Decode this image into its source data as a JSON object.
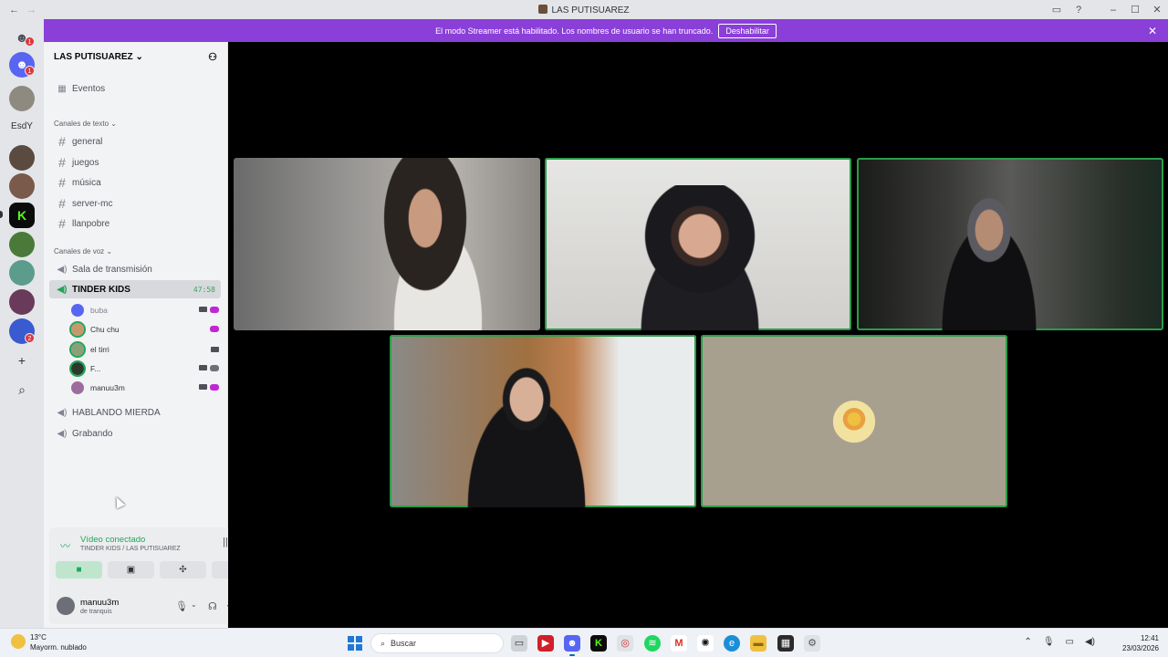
{
  "window": {
    "title": "LAS PUTISUAREZ",
    "back": "←",
    "forward": "→",
    "controls": [
      "–",
      "☐",
      "✕"
    ]
  },
  "banner": {
    "text": "El modo Streamer está habilitado. Los nombres de usuario se han truncado.",
    "button": "Deshabilitar",
    "close": "✕"
  },
  "rail": {
    "folder_text": "EsdY",
    "badges": {
      "dm": "1",
      "discord": "1",
      "bottom": "2"
    },
    "add_icon": "+",
    "explore_icon": "⌕"
  },
  "server": {
    "name": "LAS PUTISUAREZ",
    "events": "Eventos",
    "text_category": "Canales de texto",
    "text_channels": [
      "general",
      "juegos",
      "música",
      "server-mc",
      "llanpobre"
    ],
    "voice_category": "Canales de voz",
    "voice_channels": {
      "first": "Sala de transmisión",
      "active": "TINDER KIDS",
      "active_timer": "47:58",
      "rest": [
        "HABLANDO MIERDA",
        "Grabando"
      ]
    },
    "voice_users": [
      "buba",
      "Chu chu",
      "el tirri",
      "F...",
      "manuu3m"
    ]
  },
  "voice_panel": {
    "status": "Vídeo conectado",
    "channel_path": "TINDER KIDS / LAS PUTISUAREZ"
  },
  "user": {
    "name": "manuu3m",
    "status": "de tranquis"
  },
  "colors": {
    "banner": "#8b3fd9",
    "connected": "#23a55a",
    "speaking_outline": "#2a9d4a",
    "stage": "#000000"
  },
  "taskbar": {
    "weather_temp": "13°C",
    "weather_desc": "Mayorm. nublado",
    "search": "Buscar",
    "time": "12:41",
    "date": "23/03/2026"
  }
}
